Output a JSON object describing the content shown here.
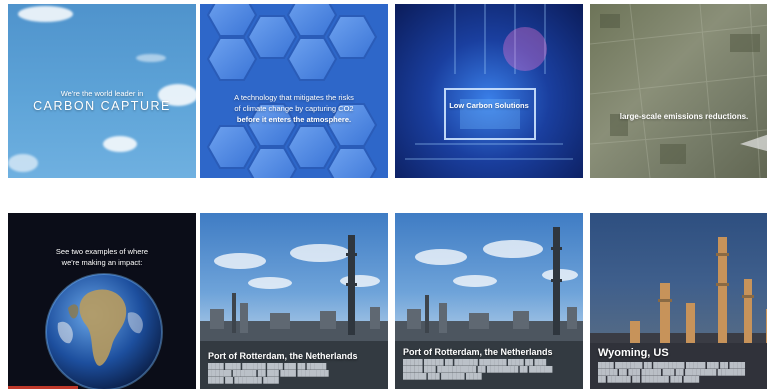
{
  "tiles": [
    {
      "lines": [
        "We're the world leader in",
        "CARBON CAPTURE"
      ]
    },
    {
      "lines": [
        "A technology that mitigates the risks",
        "of climate change by capturing CO2",
        "before it enters the atmosphere."
      ]
    },
    {
      "lines": [
        "Low Carbon Solutions"
      ]
    },
    {
      "lines": [
        "large-scale emissions reductions."
      ]
    },
    {
      "lines": [
        "See two examples of where",
        "we're making an impact:"
      ]
    },
    {
      "caption": "Port of Rotterdam, the Netherlands"
    },
    {
      "caption": "Port of Rotterdam, the Netherlands"
    },
    {
      "caption": "Wyoming, US"
    }
  ],
  "colors": {
    "accent_red": "#c0392b",
    "sky_blue": "#5ea4d8",
    "hex_blue": "#2e67c9",
    "chip_blue": "#1a3f9f"
  }
}
